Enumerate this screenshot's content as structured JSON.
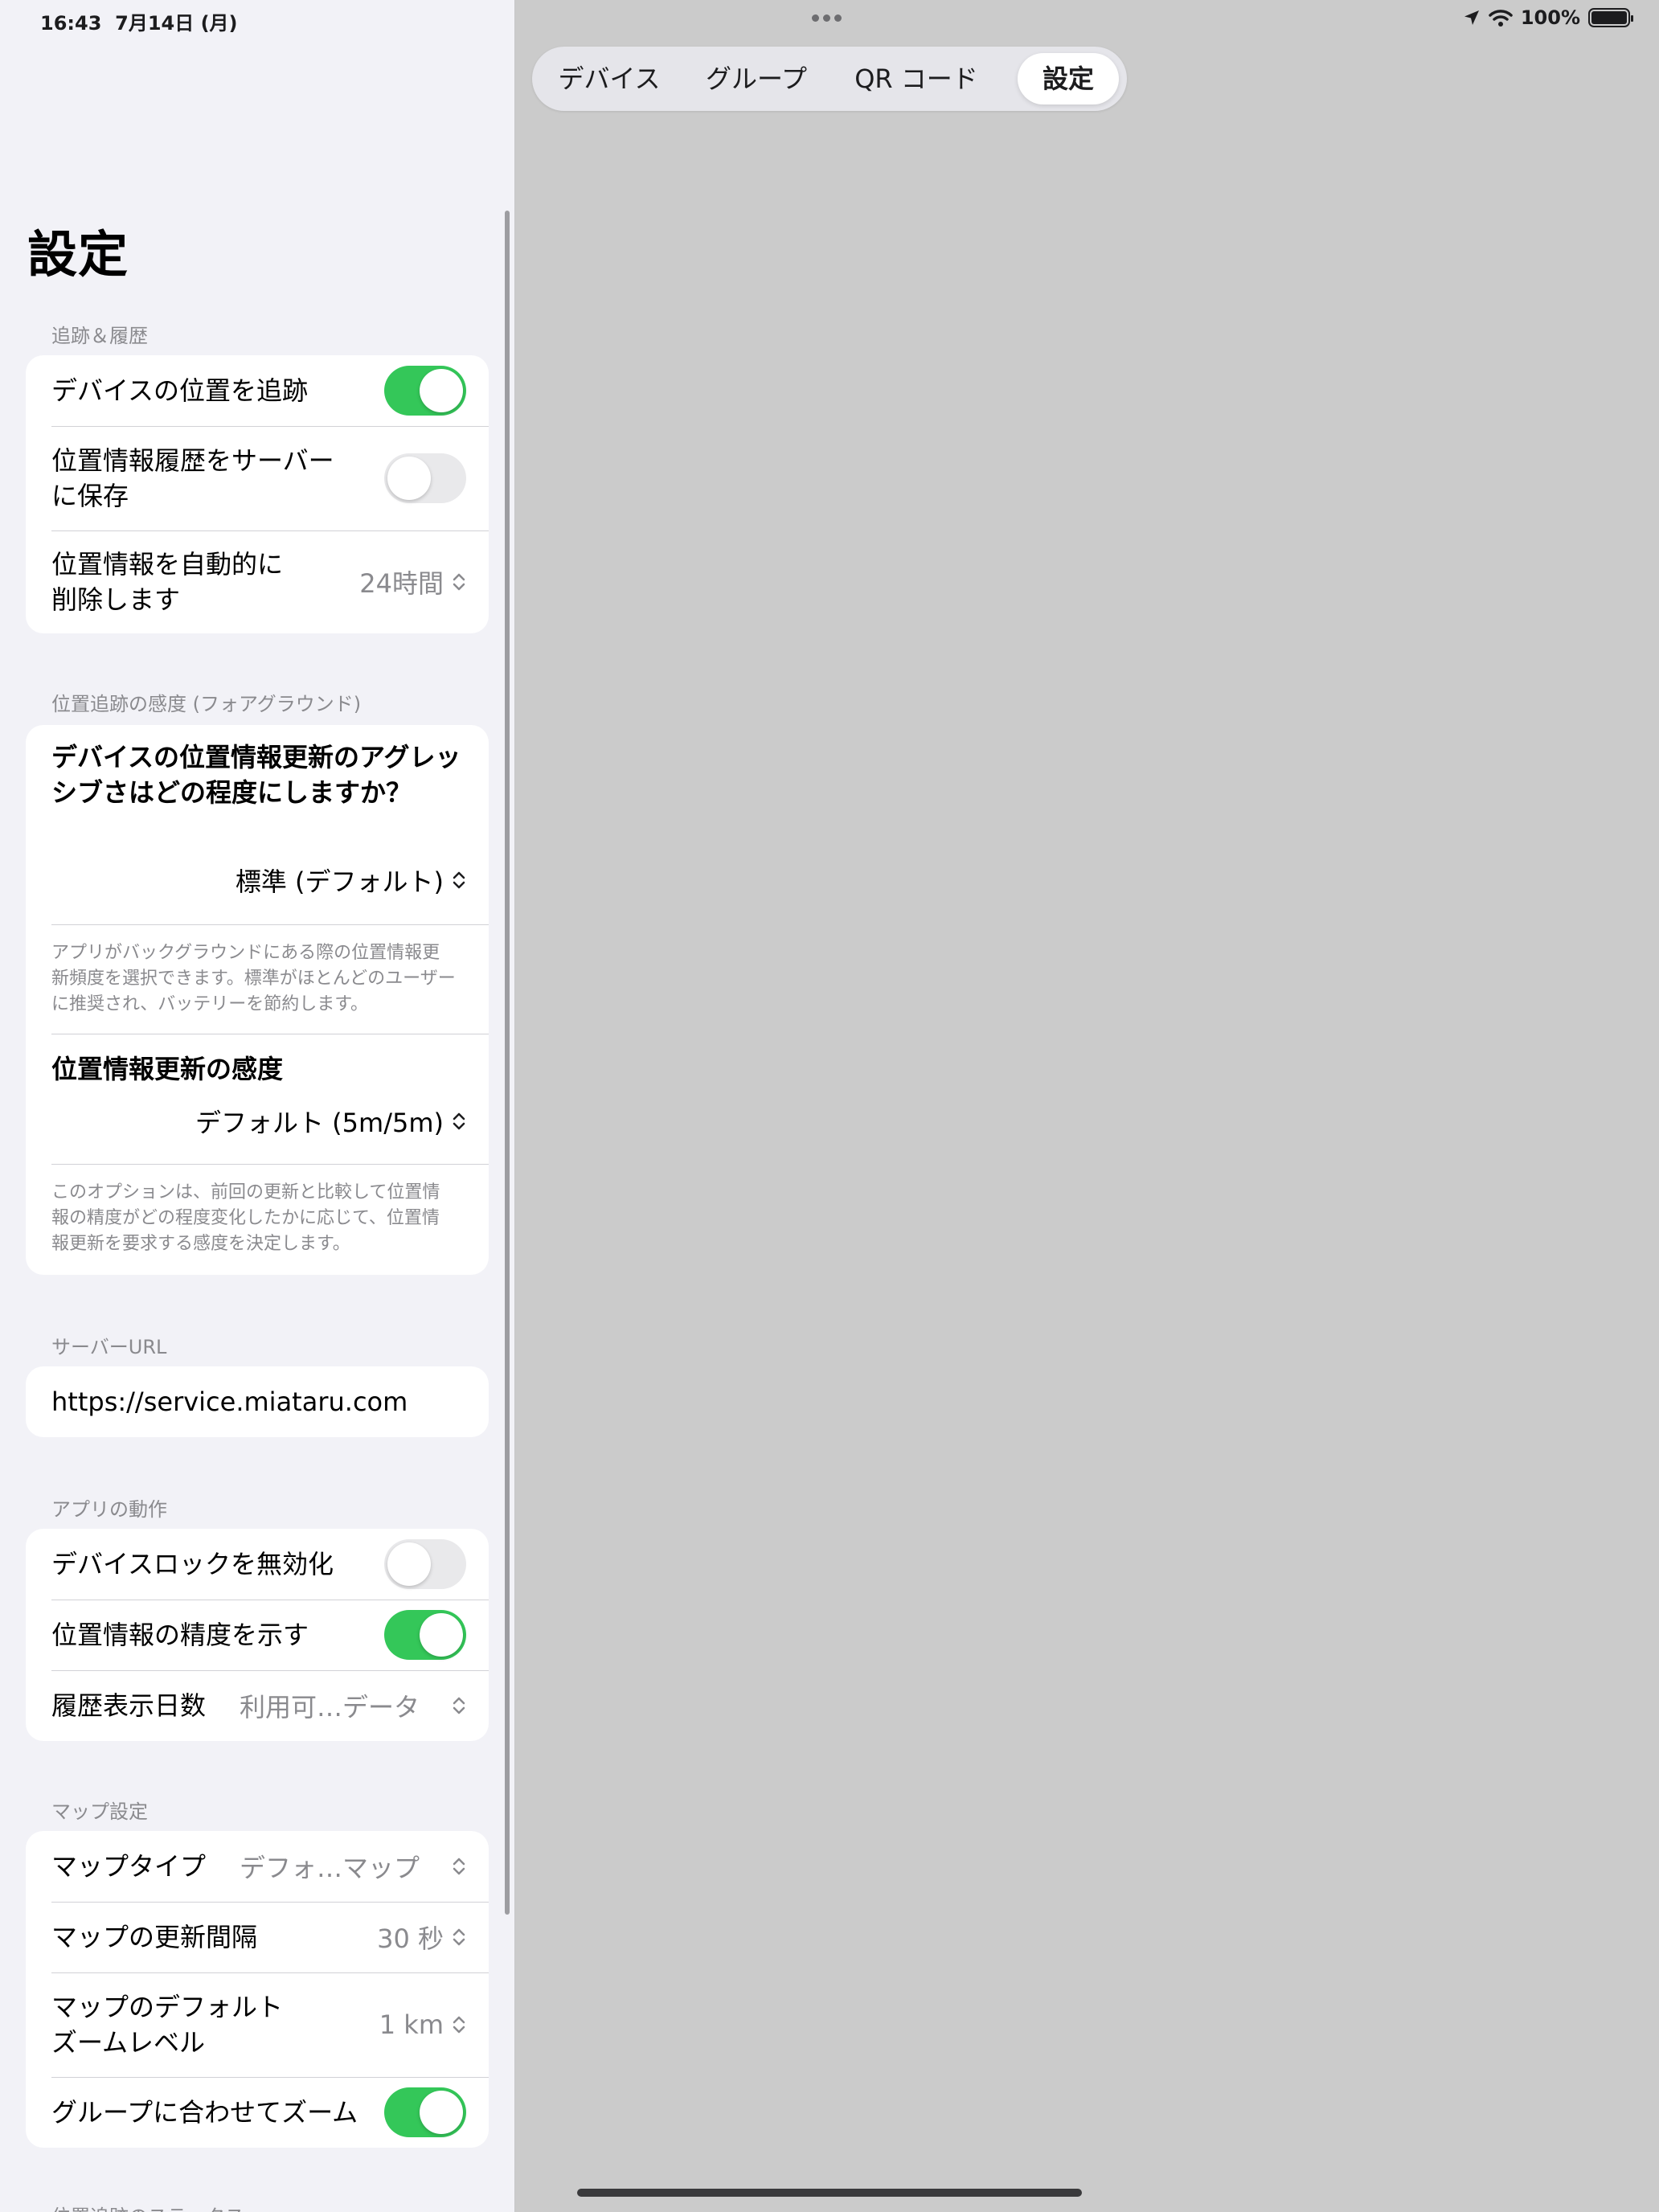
{
  "status_bar": {
    "time": "16:43",
    "date": "7月14日 (月)",
    "battery": "100%"
  },
  "tabs": [
    {
      "label": "デバイス"
    },
    {
      "label": "グループ"
    },
    {
      "label": "QR コード"
    },
    {
      "label": "設定"
    }
  ],
  "active_tab": "設定",
  "settings": {
    "title": "設定",
    "tracking": {
      "header": "追跡＆履歴",
      "track_label": "デバイスの位置を追跡",
      "track_on": true,
      "save_history_label": "位置情報履歴をサーバーに保存",
      "save_history_on": false,
      "auto_delete_label": "位置情報を自動的に削除します",
      "auto_delete_value": "24時間"
    },
    "sensitivity": {
      "header": "位置追跡の感度 (フォアグラウンド)",
      "aggressiveness_question": "デバイスの位置情報更新のアグレッシブさはどの程度にしますか？",
      "aggressiveness_value": "標準 (デフォルト)",
      "aggressiveness_desc": "アプリがバックグラウンドにある際の位置情報更新頻度を選択できます。標準がほとんどのユーザーに推奨され、バッテリーを節約します。",
      "update_label": "位置情報更新の感度",
      "update_value": "デフォルト (5m/5m)",
      "update_desc": "このオプションは、前回の更新と比較して位置情報の精度がどの程度変化したかに応じて、位置情報更新を要求する感度を決定します。"
    },
    "server": {
      "header": "サーバーURL",
      "url": "https://service.miataru.com"
    },
    "app_behavior": {
      "header": "アプリの動作",
      "disable_lock_label": "デバイスロックを無効化",
      "disable_lock_on": false,
      "show_accuracy_label": "位置情報の精度を示す",
      "show_accuracy_on": true,
      "history_days_label": "履歴表示日数",
      "history_days_value": "利用可…データ"
    },
    "map": {
      "header": "マップ設定",
      "map_type_label": "マップタイプ",
      "map_type_value": "デフォ…マップ",
      "refresh_label": "マップの更新間隔",
      "refresh_value": "30 秒",
      "zoom_label": "マップのデフォルトズームレベル",
      "zoom_value": "1 km",
      "fit_group_label": "グループに合わせてズーム",
      "fit_group_on": true
    },
    "next_header": "位置追跡のステータス"
  }
}
